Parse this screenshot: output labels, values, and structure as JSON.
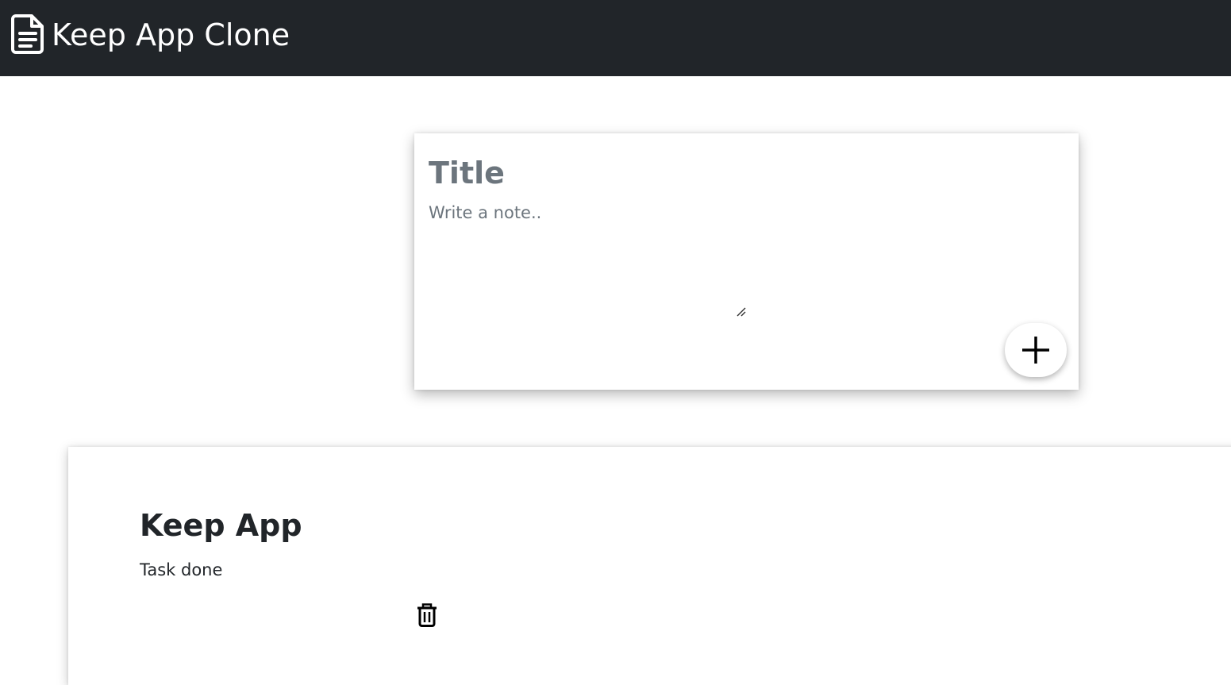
{
  "navbar": {
    "brand_icon": "file-text-icon",
    "title": "Keep App Clone",
    "background": "#212529"
  },
  "composer": {
    "title_placeholder": "Title",
    "note_placeholder": "Write a note..",
    "add_icon": "plus-icon"
  },
  "notes": [
    {
      "title": "Keep App",
      "content": "Task done",
      "delete_icon": "trash-icon"
    }
  ]
}
